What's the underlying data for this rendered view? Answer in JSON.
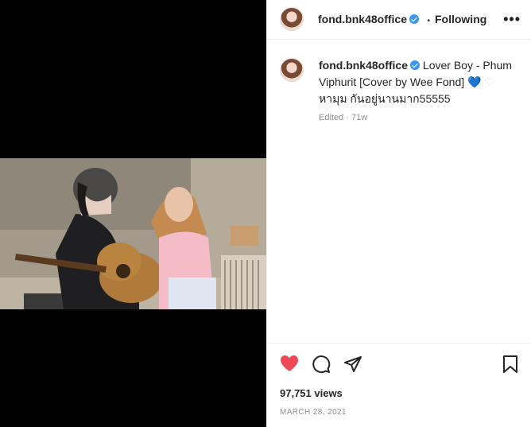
{
  "post": {
    "username": "fond.bnk48office",
    "follow_status": "Following",
    "separator": "•",
    "more_label": "•••",
    "caption_text": "Lover Boy - Phum Viphurit [Cover by Wee Fond]",
    "caption_emoji_1": "💙",
    "caption_emoji_2": "♡",
    "caption_line2": "หามุม กันอยู่นานมาก55555",
    "edited": "Edited · 71w",
    "views": "97,751 views",
    "date": "MARCH 28, 2021"
  },
  "icons": {
    "like": "heart-filled-icon",
    "comment": "comment-bubble-icon",
    "share": "paper-plane-icon",
    "save": "bookmark-icon",
    "verified": "verified-badge-icon",
    "more": "more-options-icon"
  },
  "colors": {
    "like_red": "#ed4956",
    "verified_blue": "#3897f0",
    "muted_gray": "#8e8e8e",
    "text": "#262626"
  }
}
